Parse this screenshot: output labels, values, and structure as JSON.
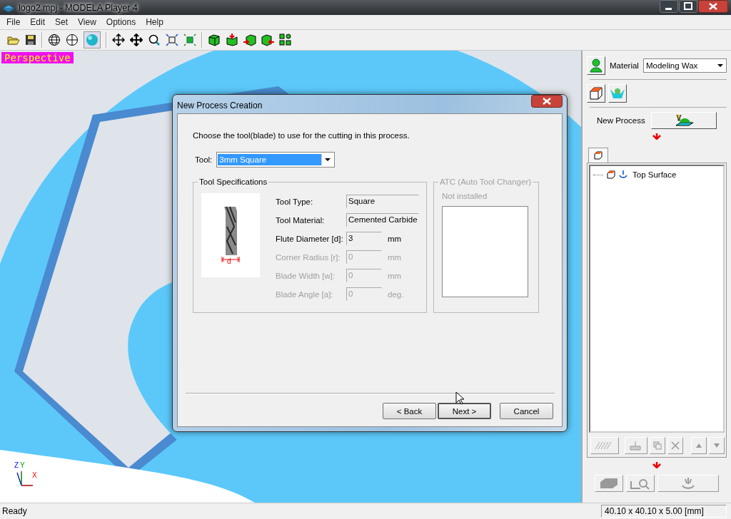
{
  "window": {
    "title": "logo2.mpj - MODELA Player 4"
  },
  "menu": [
    "File",
    "Edit",
    "Set",
    "View",
    "Options",
    "Help"
  ],
  "viewport": {
    "label": "Perspective",
    "axes": {
      "z": "Z",
      "y": "Y",
      "x": "X"
    }
  },
  "dialog": {
    "title": "New Process Creation",
    "instruction": "Choose the tool(blade) to use for the cutting in this process.",
    "tool": {
      "label": "Tool:",
      "value": "3mm Square"
    },
    "specs_title": "Tool Specifications",
    "diagram_label": "d",
    "specs": [
      {
        "label": "Tool Type:",
        "value": "Square",
        "disabled": false
      },
      {
        "label": "Tool Material:",
        "value": "Cemented Carbide",
        "disabled": false
      },
      {
        "label": "Flute Diameter [d]:",
        "value": "3",
        "unit": "mm",
        "disabled": false
      },
      {
        "label": "Corner Radius [r]:",
        "value": "0",
        "unit": "mm",
        "disabled": true
      },
      {
        "label": "Blade Width [w]:",
        "value": "0",
        "unit": "mm",
        "disabled": true
      },
      {
        "label": "Blade Angle [a]:",
        "value": "0",
        "unit": "deg.",
        "disabled": true
      }
    ],
    "atc": {
      "title": "ATC (Auto Tool Changer)",
      "status": "Not installed",
      "disabled": true
    },
    "buttons": [
      {
        "label": "< Back",
        "default": false
      },
      {
        "label": "Next >",
        "default": true
      },
      {
        "label": "Cancel",
        "default": false
      }
    ]
  },
  "panel": {
    "material_label": "Material",
    "material": "Modeling Wax",
    "new_process_label": "New Process",
    "tree": [
      {
        "label": "Top Surface",
        "selected": false
      }
    ]
  },
  "status_bar": {
    "text": "Ready",
    "dimensions": "40.10 x 40.10 x 5.00 [mm]"
  }
}
